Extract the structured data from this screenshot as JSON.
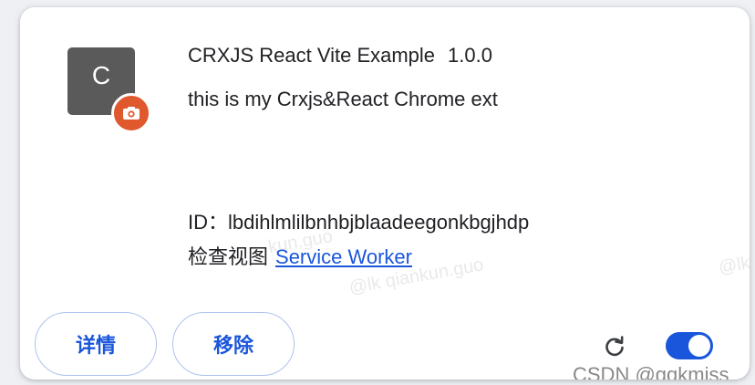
{
  "extension": {
    "icon_letter": "C",
    "icon_color": "#5a5a5a",
    "badge_color": "#e0582d",
    "badge_icon": "camera-icon",
    "name": "CRXJS React Vite Example",
    "version": "1.0.0",
    "description": "this is my Crxjs&React Chrome ext",
    "id_label": "ID：",
    "id_value": "lbdihlmlilbnhbjblaadeegonkbgjhdp",
    "inspect_label": "检查视图",
    "inspect_link": "Service Worker"
  },
  "buttons": {
    "details_label": "详情",
    "remove_label": "移除"
  },
  "controls": {
    "reload_icon": "reload-icon",
    "enabled": true,
    "accent_color": "#1a56db"
  },
  "watermarks": {
    "main": "@lk qiankun.guo",
    "top_fragment": "kun.guo",
    "right_fragment": "@lk"
  },
  "footer_watermark": "CSDN @gqkmiss"
}
